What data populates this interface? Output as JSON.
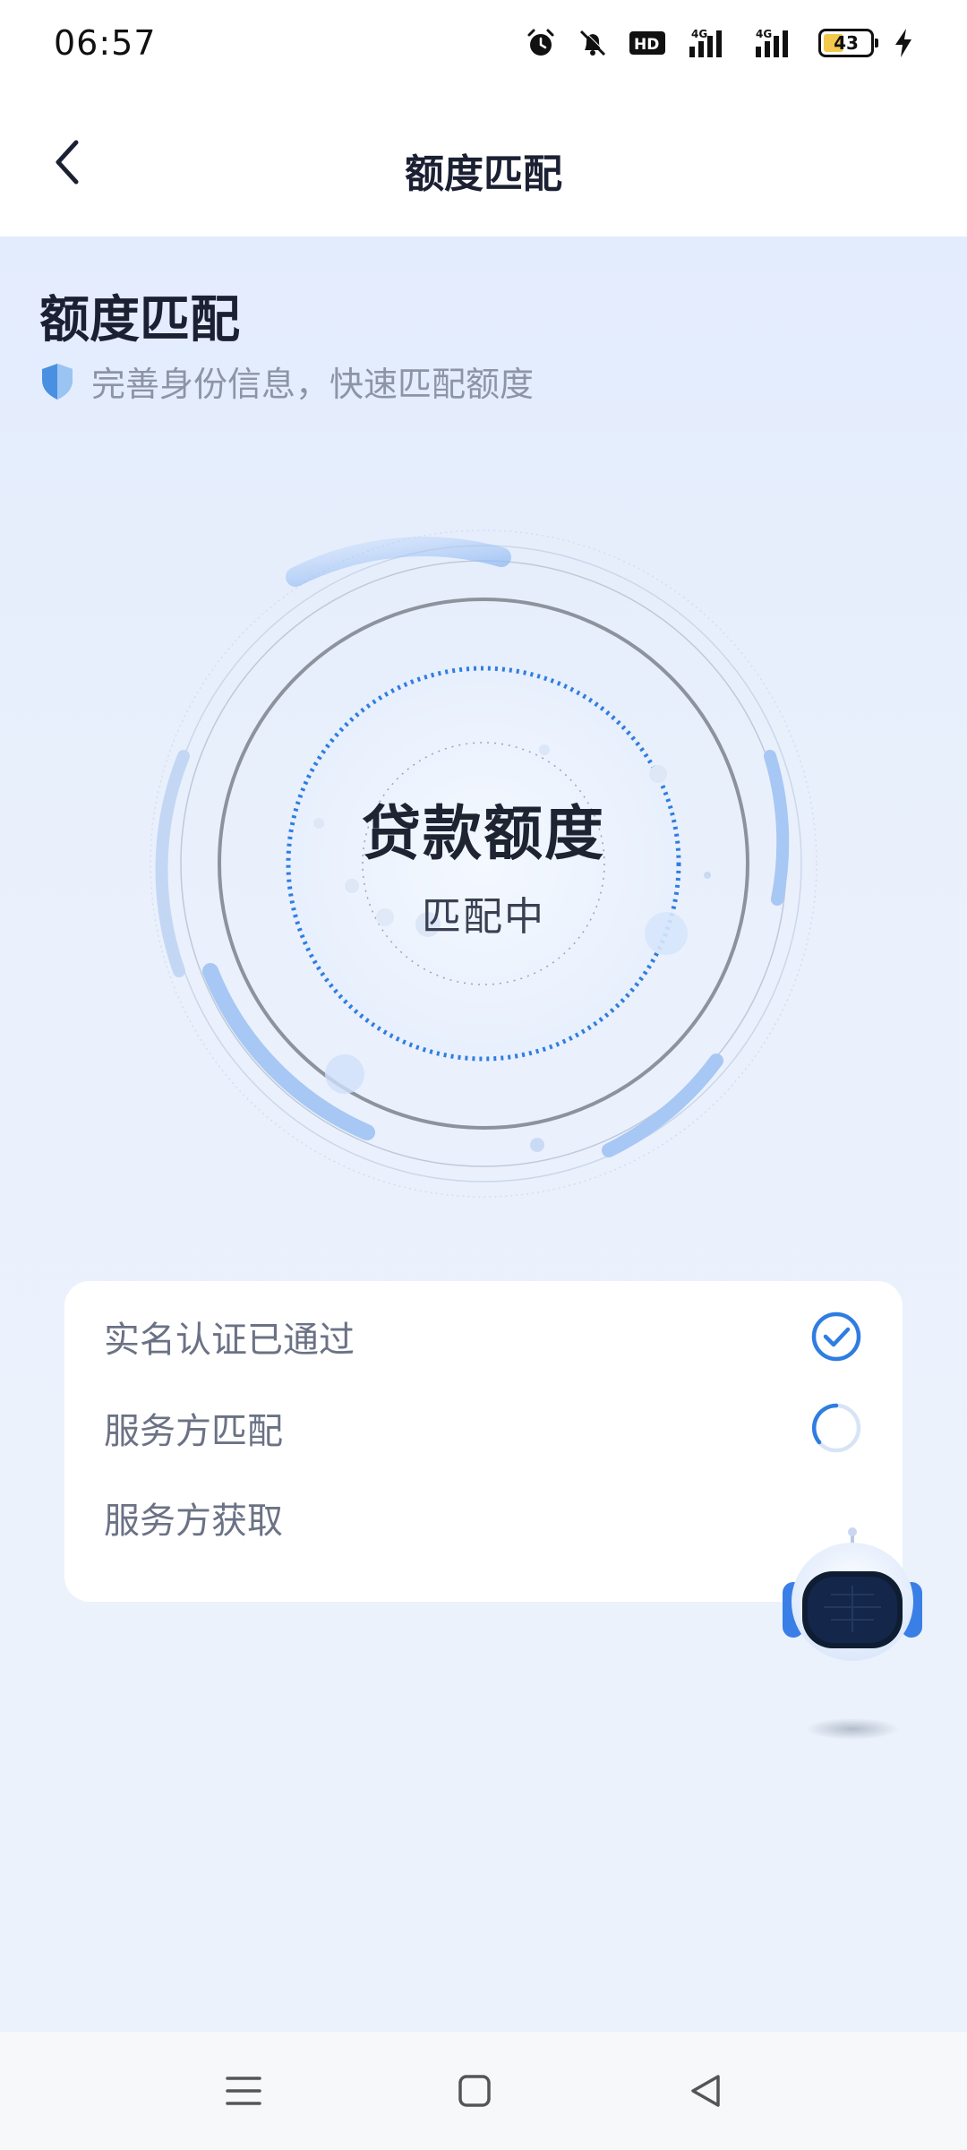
{
  "status_bar": {
    "time": "06:57",
    "battery_level": "43",
    "icons": [
      "alarm-icon",
      "bell-muted-icon",
      "hd-icon",
      "signal-4g-icon",
      "signal-4g-icon",
      "battery-icon",
      "charging-icon"
    ],
    "hd_label": "HD",
    "network_label_1": "4G",
    "network_label_2": "4G"
  },
  "header": {
    "title": "额度匹配",
    "back_icon": "chevron-left-icon"
  },
  "main": {
    "title": "额度匹配",
    "subtitle": "完善身份信息，快速匹配额度",
    "subtitle_icon": "shield-icon",
    "radar": {
      "title": "贷款额度",
      "status": "匹配中"
    },
    "steps": [
      {
        "label": "实名认证已通过",
        "state": "done",
        "icon": "check-circle-icon"
      },
      {
        "label": "服务方匹配",
        "state": "loading",
        "icon": "spinner-icon"
      },
      {
        "label": "服务方获取",
        "state": "pending",
        "icon": ""
      }
    ],
    "assistant_icon": "robot-assistant-icon"
  },
  "nav_bar": {
    "items": [
      "menu-icon",
      "home-square-icon",
      "back-triangle-icon"
    ]
  },
  "colors": {
    "accent": "#2f7de1",
    "background": "#e8effc",
    "card": "#ffffff",
    "text_primary": "#1f2433",
    "text_secondary": "#8c94a6"
  }
}
